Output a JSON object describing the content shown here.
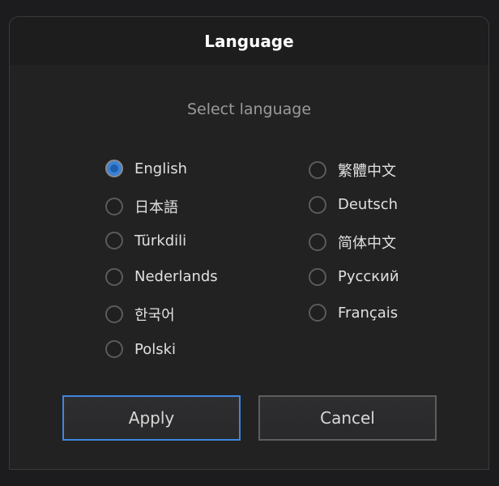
{
  "dialog": {
    "title": "Language",
    "subtitle": "Select language",
    "selected": "English",
    "languages_left": [
      {
        "label": "English",
        "checked": true
      },
      {
        "label": "日本語",
        "checked": false
      },
      {
        "label": "Türkdili",
        "checked": false
      },
      {
        "label": "Nederlands",
        "checked": false
      },
      {
        "label": "한국어",
        "checked": false
      },
      {
        "label": "Polski",
        "checked": false
      }
    ],
    "languages_right": [
      {
        "label": "繁體中文",
        "checked": false
      },
      {
        "label": "Deutsch",
        "checked": false
      },
      {
        "label": "简体中文",
        "checked": false
      },
      {
        "label": "Русский",
        "checked": false
      },
      {
        "label": "Français",
        "checked": false
      }
    ],
    "buttons": {
      "apply": "Apply",
      "cancel": "Cancel"
    },
    "colors": {
      "accent": "#3f86e0",
      "radio_selected": "#3b82d6"
    }
  }
}
